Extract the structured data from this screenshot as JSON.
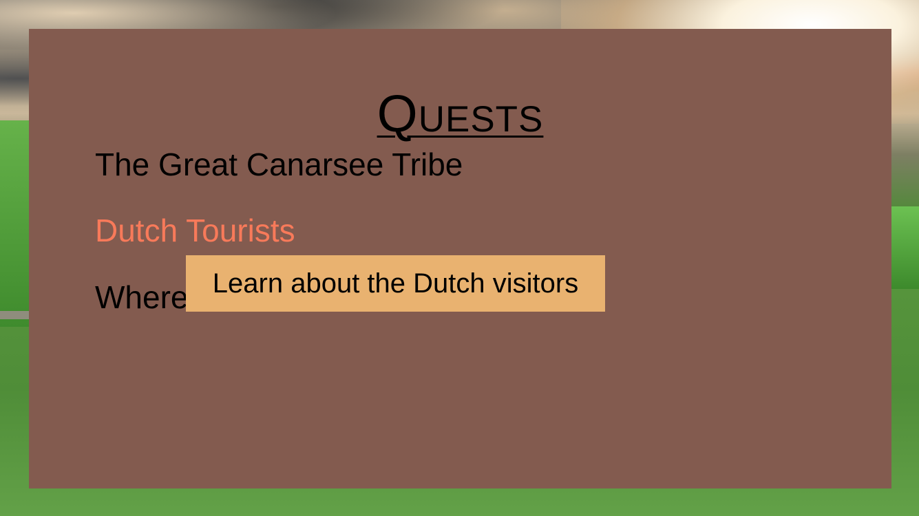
{
  "panel": {
    "title": "Quests",
    "background_color": "#835b4f",
    "quests": [
      {
        "label": "The Great Canarsee Tribe",
        "state": "normal"
      },
      {
        "label": "Dutch Tourists",
        "state": "hovered",
        "color": "#f87a5a"
      },
      {
        "label": "Where",
        "state": "normal"
      }
    ]
  },
  "tooltip": {
    "text": "Learn about the Dutch visitors",
    "background_color": "#e9b270"
  },
  "scene": {
    "environment": "sky-with-clouds-and-grass-hills"
  }
}
